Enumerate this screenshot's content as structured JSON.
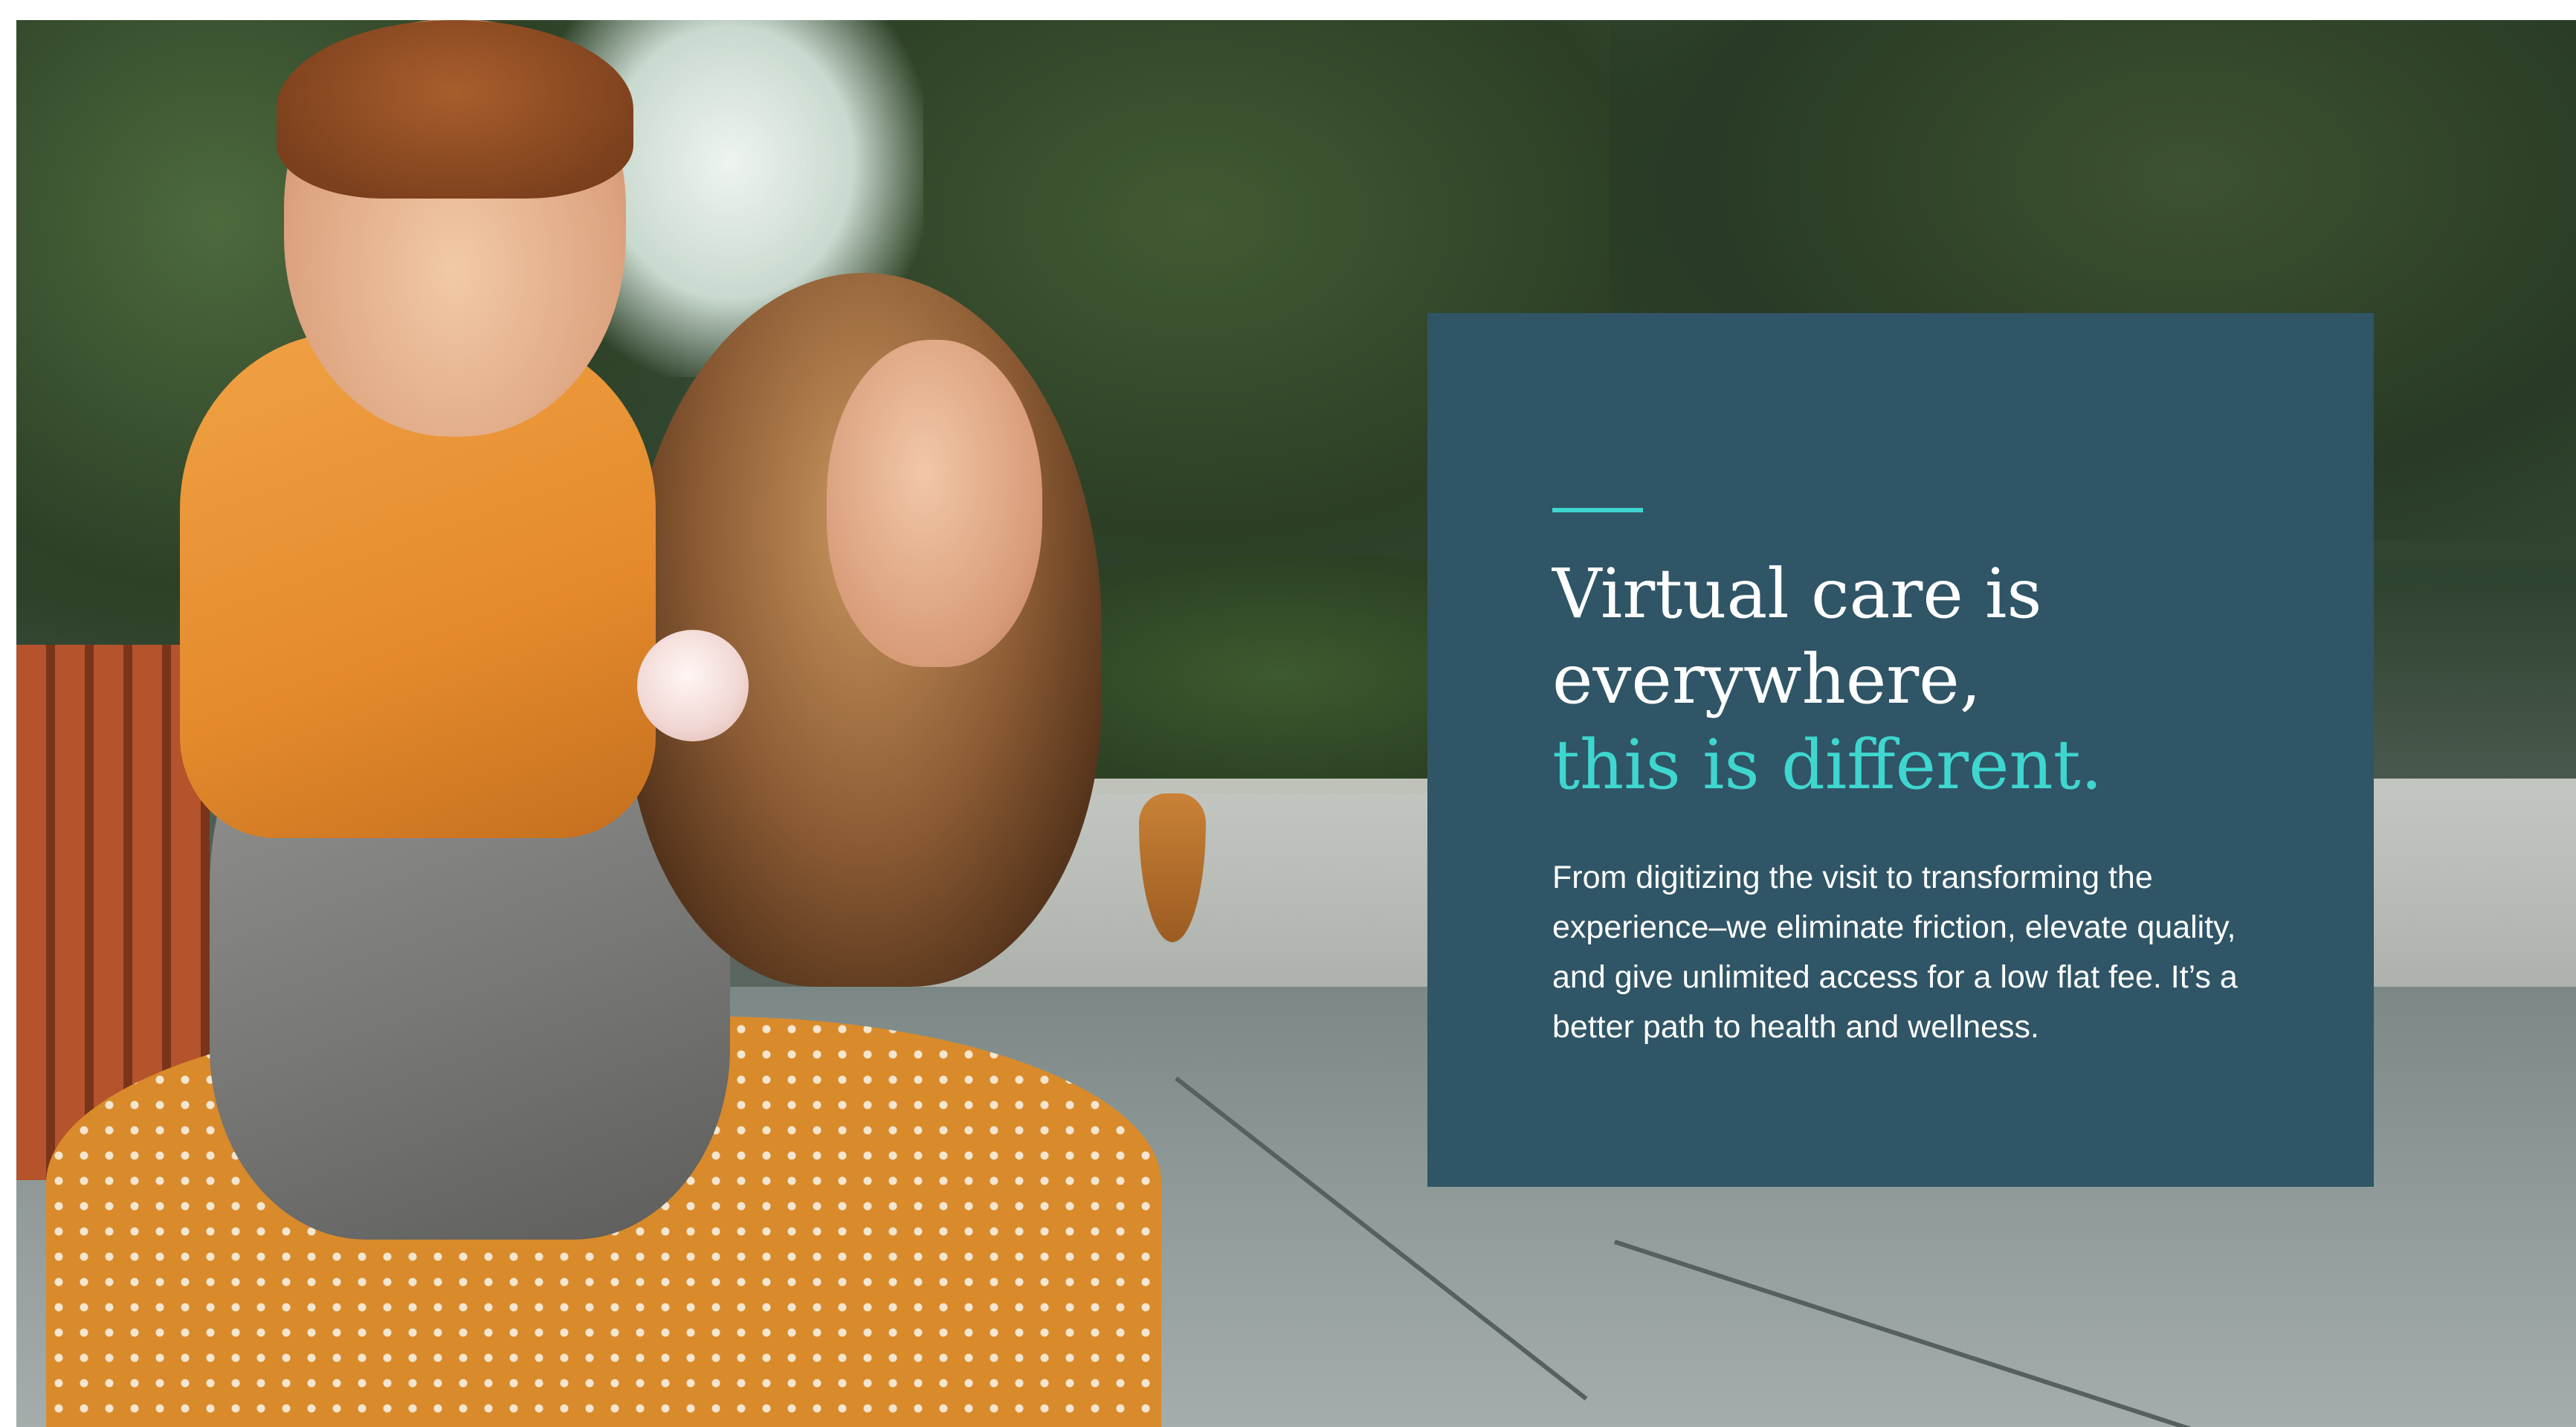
{
  "hero": {
    "image_description_icon": "photo-mother-and-son-icon",
    "headline": {
      "line1": "Virtual care is",
      "line2": "everywhere,",
      "accent_line": "this is different."
    },
    "body": "From digitizing the visit to transforming the experience–we eliminate friction, elevate quality, and give unlimited access for a low flat fee. It’s a better path to health and wellness."
  },
  "colors": {
    "card_background": "#2f5566",
    "accent": "#3fd6cf",
    "text": "#ffffff"
  }
}
